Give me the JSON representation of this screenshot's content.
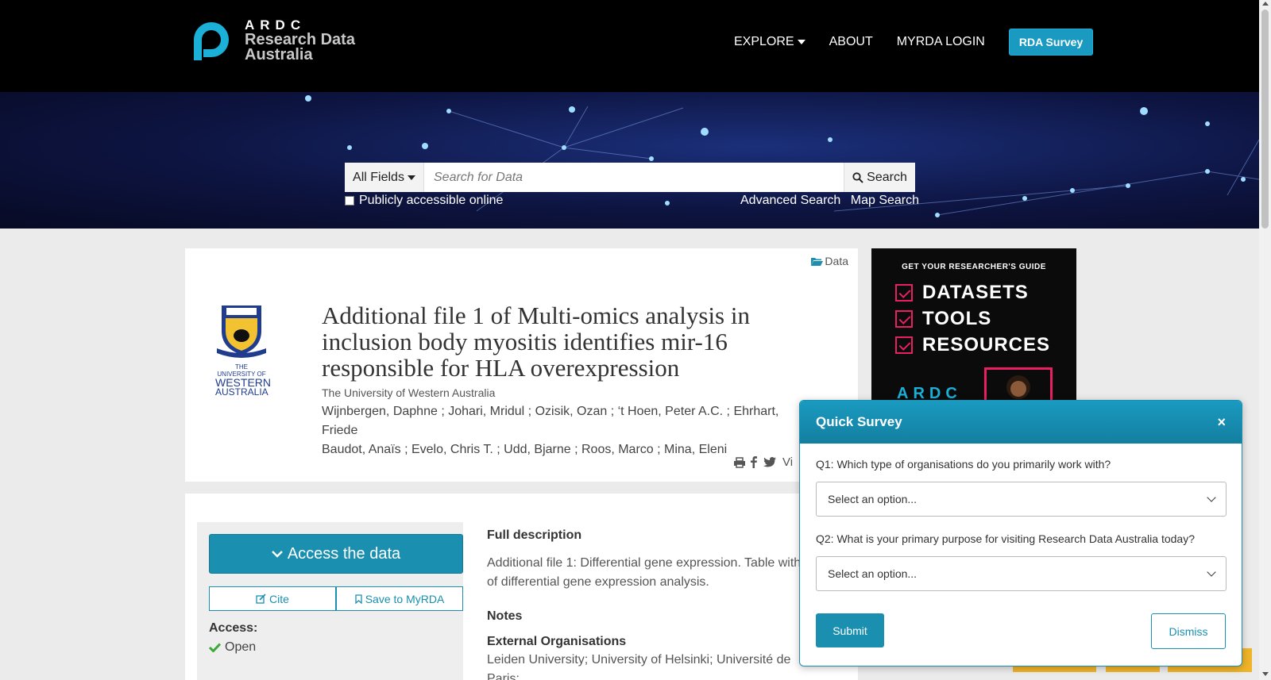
{
  "header": {
    "logo_ardc": "ARDC",
    "logo_line1": "Research Data",
    "logo_line2": "Australia",
    "nav": {
      "explore": "EXPLORE",
      "about": "ABOUT",
      "login": "MYRDA LOGIN",
      "survey": "RDA Survey"
    }
  },
  "search": {
    "fields_label": "All Fields",
    "placeholder": "Search for Data",
    "button_label": "Search",
    "public_label": "Publicly accessible online",
    "advanced_label": "Advanced Search",
    "map_label": "Map Search"
  },
  "record": {
    "type": "Data",
    "title": "Additional file 1 of Multi-omics analysis in inclusion body myositis identifies mir-16 responsible for HLA overexpression",
    "publisher": "The University of Western Australia",
    "authors_line1": "Wijnbergen, Daphne ; Johari, Mridul ; Ozisik, Ozan ; ‘t Hoen, Peter A.C. ; Ehrhart, Friede",
    "authors_line2": "Baudot, Anaïs ; Evelo, Chris T. ; Udd, Bjarne ; Roos, Marco ; Mina, Eleni",
    "share_view": "Vi",
    "uwa_logo_text1": "THE UNIVERSITY OF",
    "uwa_logo_text2": "WESTERN",
    "uwa_logo_text3": "AUSTRALIA"
  },
  "sidebar": {
    "access_button": "Access the data",
    "cite": "Cite",
    "save": "Save to MyRDA",
    "access_label": "Access:",
    "access_value": "Open"
  },
  "content": {
    "full_description_heading": "Full description",
    "full_description_line1": "Additional file 1: Differential gene expression. Table with",
    "full_description_line2": "of differential gene expression analysis.",
    "notes_heading": "Notes",
    "ext_org_heading": "External Organisations",
    "ext_org_value": "Leiden University; University of Helsinki; Université de Paris;"
  },
  "ad": {
    "guide": "GET YOUR RESEARCHER'S GUIDE",
    "items": [
      "DATASETS",
      "TOOLS",
      "RESOURCES"
    ],
    "brand": "ARDC"
  },
  "survey": {
    "title": "Quick Survey",
    "close": "×",
    "q1": "Q1: Which type of organisations do you primarily work with?",
    "q1_value": "Select an option...",
    "q2": "Q2: What is your primary purpose for visiting Research Data Australia today?",
    "q2_value": "Select an option...",
    "submit": "Submit",
    "dismiss": "Dismiss"
  },
  "colors": {
    "accent": "#1a8fb0",
    "header_bg": "#000000",
    "ad_pink": "#e91e63"
  }
}
